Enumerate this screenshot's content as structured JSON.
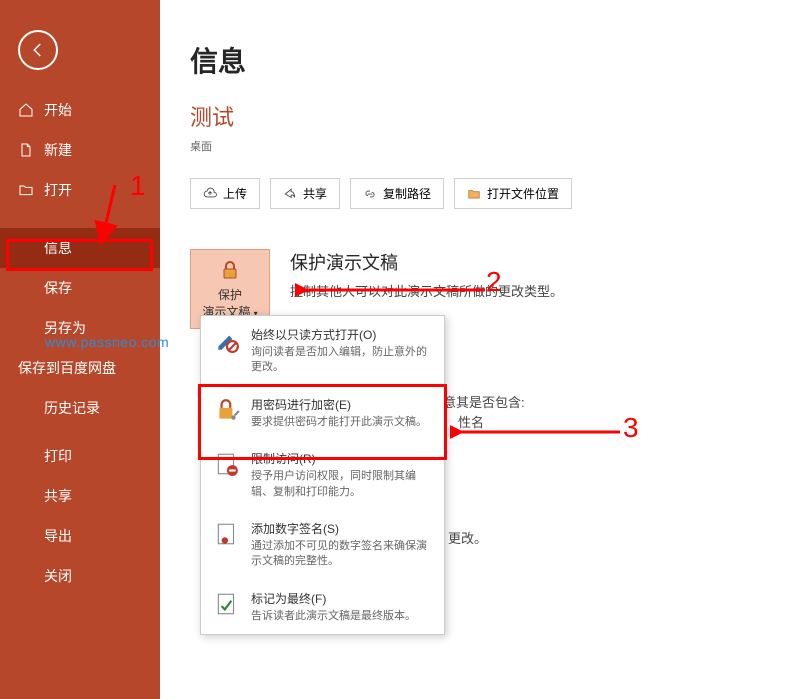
{
  "sidebar": {
    "back": "返回",
    "items": [
      {
        "label": "开始",
        "icon": "home-icon"
      },
      {
        "label": "新建",
        "icon": "file-icon"
      },
      {
        "label": "打开",
        "icon": "folder-icon"
      },
      {
        "label": "信息",
        "icon": null,
        "active": true
      },
      {
        "label": "保存",
        "icon": null
      },
      {
        "label": "另存为",
        "icon": null
      },
      {
        "label": "保存到百度网盘",
        "icon": null
      },
      {
        "label": "历史记录",
        "icon": null
      },
      {
        "label": "打印",
        "icon": null
      },
      {
        "label": "共享",
        "icon": null
      },
      {
        "label": "导出",
        "icon": null
      },
      {
        "label": "关闭",
        "icon": null
      }
    ]
  },
  "page": {
    "title": "信息",
    "fileTitle": "测试",
    "breadcrumb": "桌面"
  },
  "actions": {
    "upload": "上传",
    "share": "共享",
    "copyPath": "复制路径",
    "openLocation": "打开文件位置"
  },
  "protect": {
    "tileLine1": "保护",
    "tileLine2": "演示文稿",
    "heading": "保护演示文稿",
    "desc": "控制其他人可以对此演示文稿所做的更改类型。"
  },
  "menu": {
    "items": [
      {
        "title": "始终以只读方式打开(O)",
        "desc": "询问读者是否加入编辑，防止意外的更改。"
      },
      {
        "title": "用密码进行加密(E)",
        "desc": "要求提供密码才能打开此演示文稿。"
      },
      {
        "title": "限制访问(R)",
        "desc": "授予用户访问权限，同时限制其编辑、复制和打印能力。"
      },
      {
        "title": "添加数字签名(S)",
        "desc": "通过添加不可见的数字签名来确保演示文稿的完整性。"
      },
      {
        "title": "标记为最终(F)",
        "desc": "告诉读者此演示文稿是最终版本。"
      }
    ]
  },
  "extras": {
    "line1": "意其是否包含:",
    "line2": "性名",
    "line3": "更改。"
  },
  "annotations": {
    "n1": "1",
    "n2": "2",
    "n3": "3"
  },
  "watermark": "www.passneo.com"
}
